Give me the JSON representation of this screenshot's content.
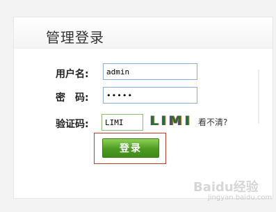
{
  "page": {
    "title": "管理登录"
  },
  "form": {
    "username_label": "用户名:",
    "username_value": "admin",
    "password_label": "密　码:",
    "password_value": "•••••",
    "captcha_label": "验证码:",
    "captcha_value": "LIMI",
    "captcha_image_text": "LIMI",
    "refresh_label": "看不清?",
    "submit_label": "登录"
  },
  "watermark": {
    "text": "Baidu经验",
    "sub": "jingyan.baidu.com"
  },
  "colors": {
    "button_green": "#4c9a22",
    "field_border": "#8aaed3",
    "highlight_red": "#c0392b"
  }
}
